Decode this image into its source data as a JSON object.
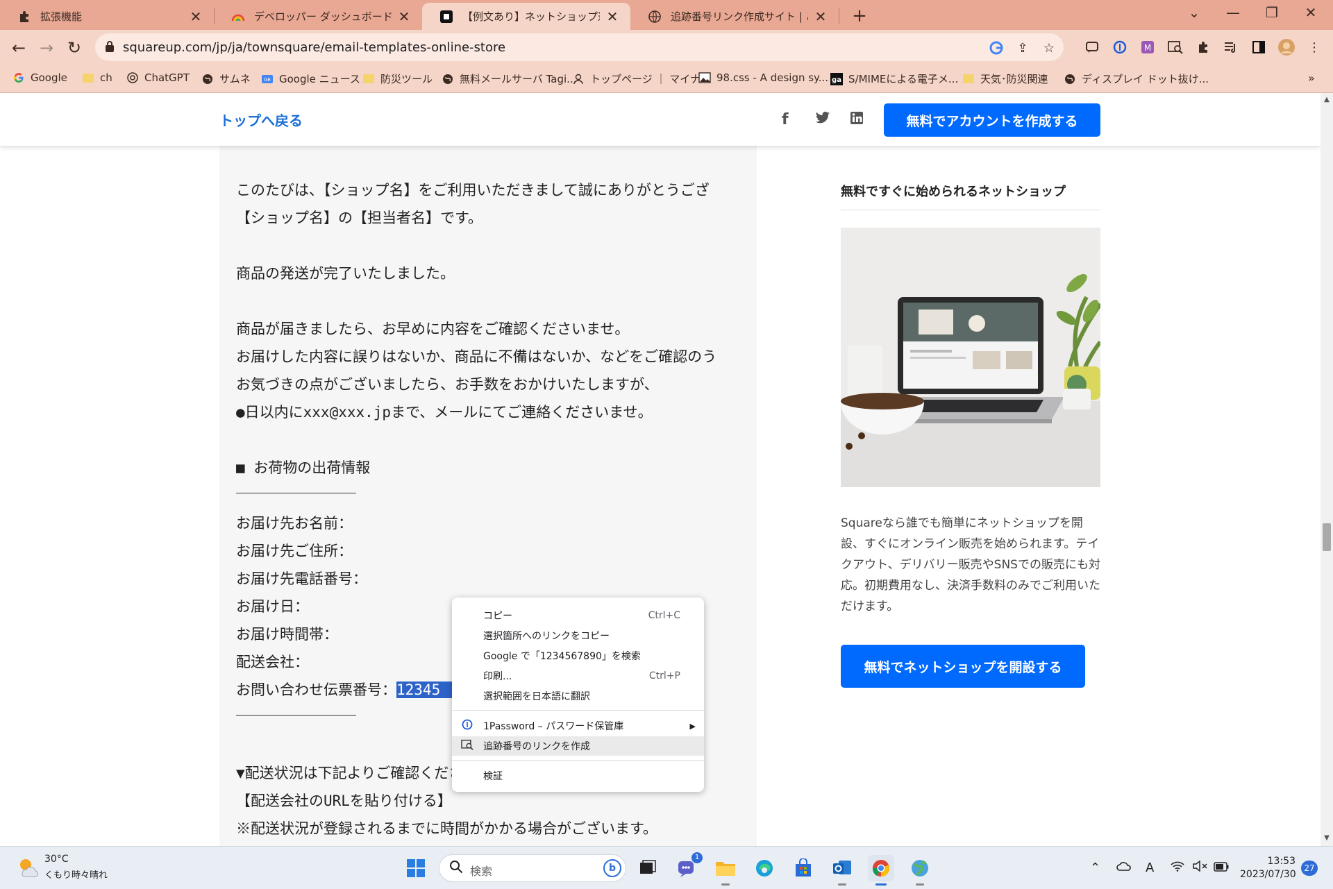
{
  "browser": {
    "tabs": [
      {
        "title": "拡張機能",
        "icon": "puzzle-icon"
      },
      {
        "title": "デベロッパー ダッシュボード",
        "icon": "rainbow-icon"
      },
      {
        "title": "【例文あり】ネットショップ運営に必要",
        "icon": "square-logo-icon"
      },
      {
        "title": "追跡番号リンク作成サイト | ご依頼の",
        "icon": "globe-icon"
      }
    ],
    "url": "squareup.com/jp/ja/townsquare/email-templates-online-store",
    "bookmarks": [
      {
        "label": "Google",
        "icon": "google-icon"
      },
      {
        "label": "ch",
        "icon": "folder-icon"
      },
      {
        "label": "ChatGPT",
        "icon": "chatgpt-icon"
      },
      {
        "label": "サムネ",
        "icon": "globe-icon"
      },
      {
        "label": "Google ニュース",
        "icon": "google-news-icon"
      },
      {
        "label": "防災ツール",
        "icon": "folder-icon"
      },
      {
        "label": "無料メールサーバ Tagi...",
        "icon": "globe-icon"
      },
      {
        "label": "トップページ ｜ マイナ...",
        "icon": "person-icon"
      },
      {
        "label": "98.css - A design sy...",
        "icon": "image-icon"
      },
      {
        "label": "S/MIMEによる電子メ...",
        "icon": "ga-logo-icon"
      },
      {
        "label": "天気･防災関連",
        "icon": "folder-icon"
      },
      {
        "label": "ディスプレイ ドット抜け...",
        "icon": "globe-icon"
      }
    ]
  },
  "site": {
    "back_label": "トップへ戻る",
    "cta_top": "無料でアカウントを作成する",
    "social": [
      "f",
      "t",
      "in"
    ]
  },
  "mail": {
    "lines": [
      "このたびは、【ショップ名】をご利用いただきまして誠にありがとうござ",
      "【ショップ名】の【担当者名】です。",
      "商品の発送が完了いたしました。",
      "商品が届きましたら、お早めに内容をご確認くださいませ。",
      "お届けした内容に誤りはないか、商品に不備はないか、などをご確認のう",
      "お気づきの点がございましたら、お手数をおかけいたしますが、",
      "●日以内にxxx@xxx.jpまで、メールにてご連絡くださいませ。",
      "■ お荷物の出荷情報",
      "お届け先お名前：",
      "お届け先ご住所：",
      "お届け先電話番号：",
      "お届け日：",
      "お届け時間帯：",
      "配送会社：",
      "お問い合わせ伝票番号：",
      "▼配送状況は下記よりご確認ください。",
      "【配送会社のURLを貼り付ける】",
      "※配送状況が登録されるまでに時間がかかる場合がございます。"
    ],
    "selected_text": "12345"
  },
  "sidebar": {
    "title": "無料ですぐに始められるネットショップ",
    "body": "Squareなら誰でも簡単にネットショップを開設、すぐにオンライン販売を始められます。テイクアウト、デリバリー販売やSNSでの販売にも対応。初期費用なし、決済手数料のみでご利用いただけます。",
    "cta": "無料でネットショップを開設する"
  },
  "context_menu": {
    "items": [
      {
        "label": "コピー",
        "shortcut": "Ctrl+C"
      },
      {
        "label": "選択箇所へのリンクをコピー",
        "shortcut": ""
      },
      {
        "label": "Google で「1234567890」を検索",
        "shortcut": ""
      },
      {
        "label": "印刷...",
        "shortcut": "Ctrl+P"
      },
      {
        "label": "選択範囲を日本語に翻訳",
        "shortcut": ""
      },
      {
        "label": "1Password – パスワード保管庫",
        "shortcut": "",
        "icon": "1password-icon",
        "submenu": true
      },
      {
        "label": "追跡番号のリンクを作成",
        "shortcut": "",
        "icon": "link-search-icon",
        "hovered": true
      },
      {
        "label": "検証",
        "shortcut": ""
      }
    ]
  },
  "taskbar": {
    "weather_temp": "30°C",
    "weather_desc": "くもり時々晴れ",
    "search_placeholder": "検索",
    "time": "13:53",
    "date": "2023/07/30",
    "notifications": "27",
    "chat_badge": "1"
  },
  "colors": {
    "tab_strip": "#e8a894",
    "toolbar": "#f4d5c8",
    "accent_blue": "#006aff",
    "link_blue": "#1a6fd4",
    "selection": "#2d63c8"
  }
}
